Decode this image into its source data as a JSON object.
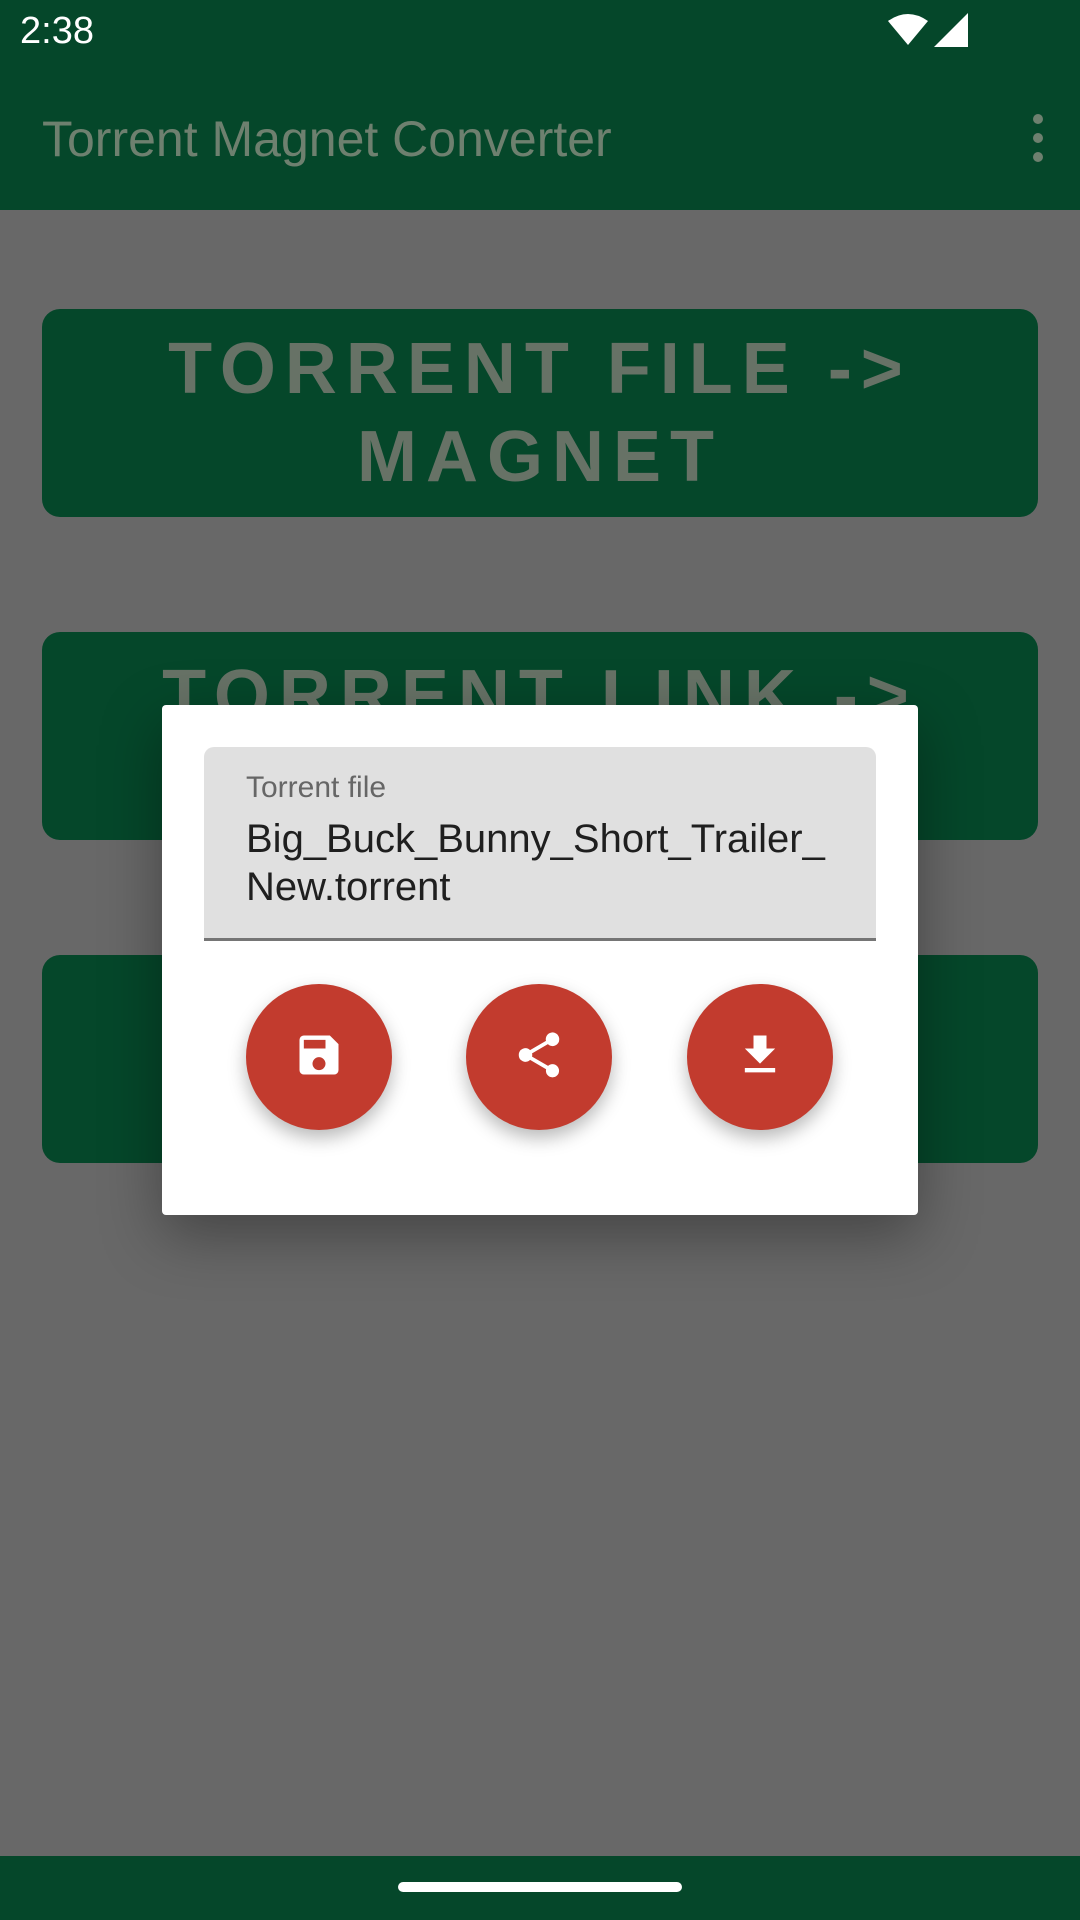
{
  "status_bar": {
    "time": "2:38"
  },
  "app_bar": {
    "title": "Torrent Magnet Converter",
    "menu_icon": "more-vert-icon"
  },
  "main": {
    "buttons": [
      {
        "label": "TORRENT FILE -> MAGNET"
      },
      {
        "label": "TORRENT LINK ->"
      },
      {
        "label": ""
      }
    ]
  },
  "dialog": {
    "field_label": "Torrent file",
    "field_value": "Big_Buck_Bunny_Short_Trailer_New.torrent",
    "actions": [
      {
        "icon": "save-icon"
      },
      {
        "icon": "share-icon"
      },
      {
        "icon": "download-icon"
      }
    ]
  },
  "colors": {
    "primary_dark": "#05472a",
    "accent": "#c23b2e",
    "scrim": "#686868"
  }
}
